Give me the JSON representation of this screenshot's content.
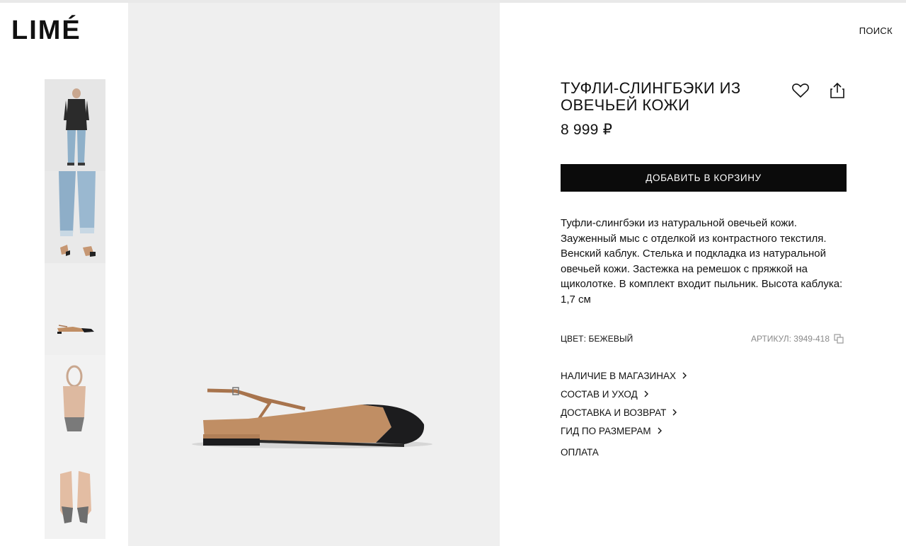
{
  "brand": {
    "logo": "LIMÉ"
  },
  "header": {
    "search_label": "ПОИСК"
  },
  "gallery": {
    "thumbnails": [
      {
        "alt_icon": "model-full-body-thumb"
      },
      {
        "alt_icon": "model-legs-thumb"
      },
      {
        "alt_icon": "shoe-side-thumb"
      },
      {
        "alt_icon": "shoe-back-thumb"
      },
      {
        "alt_icon": "shoe-top-thumb"
      }
    ]
  },
  "product": {
    "title": "ТУФЛИ-СЛИНГБЭКИ ИЗ ОВЕЧЬЕЙ КОЖИ",
    "price": "8 999 ₽",
    "add_to_cart": "ДОБАВИТЬ В КОРЗИНУ",
    "description": "Туфли-слингбэки из натуральной овечьей кожи. Зауженный мыс с отделкой из контрастного текстиля. Венский каблук. Стелька и подкладка из натуральной овечьей кожи. Застежка на ремешок с пряжкой на щиколотке. В комплект входит пыльник. Высота каблука: 1,7 см",
    "color_label": "ЦВЕТ: БЕЖЕВЫЙ",
    "sku_label": "АРТИКУЛ: 3949-418"
  },
  "links": [
    {
      "label": "НАЛИЧИЕ В МАГАЗИНАХ"
    },
    {
      "label": "СОСТАВ И УХОД"
    },
    {
      "label": "ДОСТАВКА И ВОЗВРАТ"
    },
    {
      "label": "ГИД ПО РАЗМЕРАМ"
    }
  ],
  "payment_label": "ОПЛАТА",
  "colors": {
    "button_bg": "#0b0b0b",
    "image_bg": "#efefef",
    "shoe_tan": "#c08e64",
    "shoe_toe": "#1c1c1e"
  }
}
